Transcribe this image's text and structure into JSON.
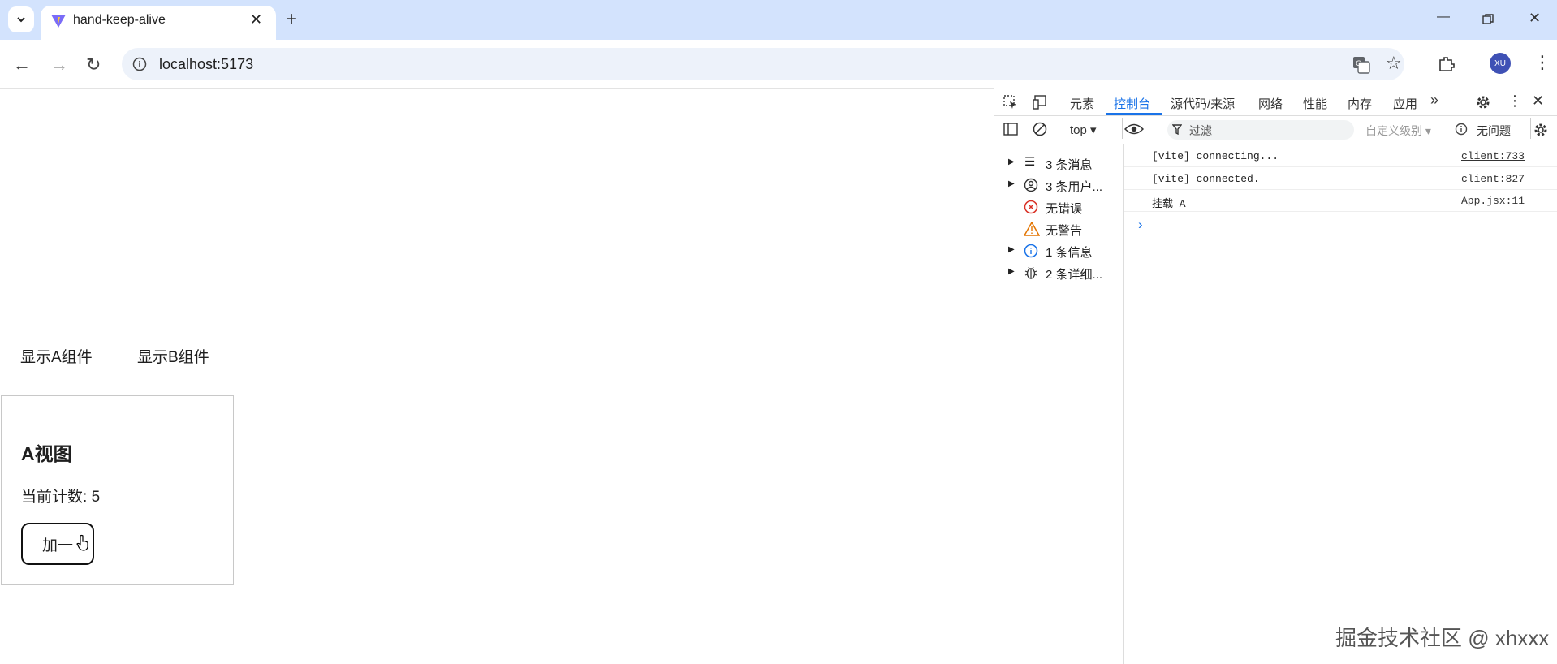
{
  "browser": {
    "tab_title": "hand-keep-alive",
    "url": "localhost:5173",
    "avatar_initials": "XU"
  },
  "page": {
    "show_a_label": "显示A组件",
    "show_b_label": "显示B组件",
    "card_title": "A视图",
    "count_label": "当前计数:",
    "count_value": "5",
    "add_button_label": "加一"
  },
  "devtools": {
    "tabs": [
      "元素",
      "控制台",
      "源代码/来源",
      "网络",
      "性能",
      "内存",
      "应用"
    ],
    "active_tab": "控制台",
    "context": "top",
    "filter_placeholder": "过滤",
    "level_select": "自定义级别",
    "issues": "无问题",
    "sidebar": [
      "3 条消息",
      "3 条用户...",
      "无错误",
      "无警告",
      "1 条信息",
      "2 条详细..."
    ],
    "logs": [
      {
        "text": "[vite] connecting...",
        "source": "client:733"
      },
      {
        "text": "[vite] connected.",
        "source": "client:827"
      },
      {
        "text": "挂载 A",
        "source": "App.jsx:11"
      }
    ],
    "prompt": "›"
  },
  "watermark": "掘金技术社区 @ xhxxx"
}
